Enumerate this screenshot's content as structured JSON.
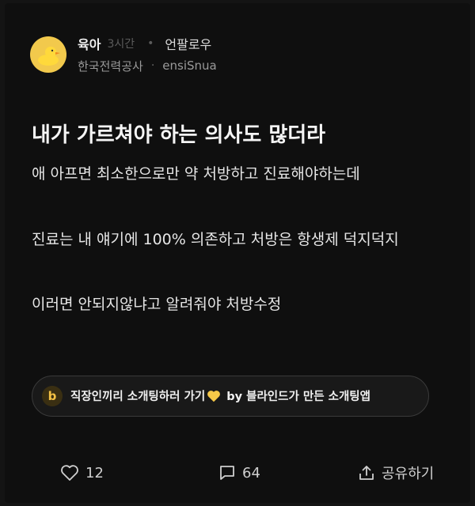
{
  "post": {
    "category": "육아",
    "time": "3시간",
    "follow_label": "언팔로우",
    "company": "한국전력공사",
    "nickname": "ensiSnua",
    "title": "내가 가르쳐야 하는 의사도 많더라",
    "body": [
      "애 아프면 최소한으로만 약 처방하고 진료해야하는데",
      "진료는 내 얘기에 100% 의존하고 처방은 항생제 덕지덕지",
      "이러면 안되지않냐고 알려줘야 처방수정"
    ]
  },
  "ad": {
    "logo": "b",
    "text_before": "직장인끼리 소개팅하러 가기",
    "text_after": "by 블라인드가 만든 소개팅앱",
    "icon": "yellow-heart-icon"
  },
  "actions": {
    "likes": "12",
    "comments": "64",
    "share_label": "공유하기"
  },
  "colors": {
    "background": "#0f0f0f",
    "avatar": "#f2c94c",
    "accent": "#f5c245"
  }
}
